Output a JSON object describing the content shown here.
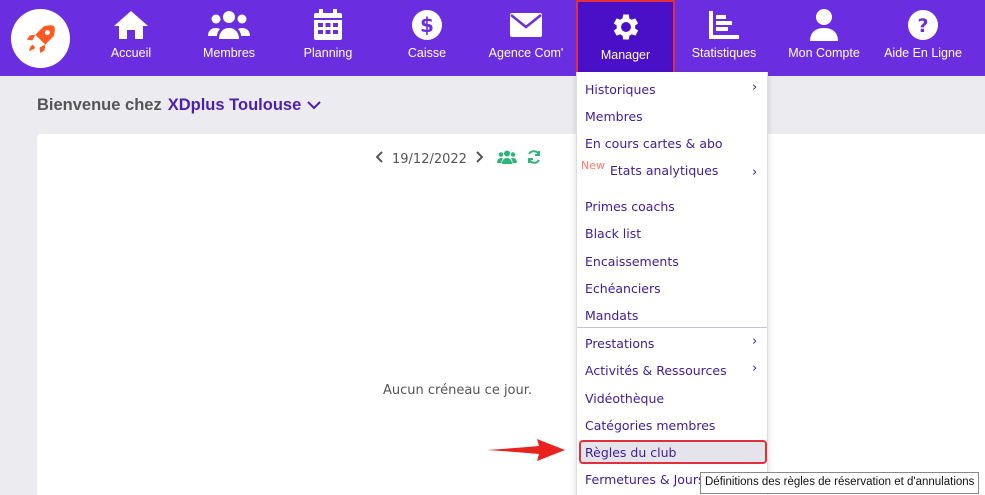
{
  "nav": {
    "items": [
      {
        "label": "Accueil",
        "icon": "home-icon"
      },
      {
        "label": "Membres",
        "icon": "members-icon"
      },
      {
        "label": "Planning",
        "icon": "calendar-icon"
      },
      {
        "label": "Caisse",
        "icon": "dollar-icon"
      },
      {
        "label": "Agence Com'",
        "icon": "envelope-icon"
      },
      {
        "label": "Manager",
        "icon": "gear-icon",
        "active": true
      },
      {
        "label": "Statistiques",
        "icon": "stats-icon"
      },
      {
        "label": "Mon Compte",
        "icon": "user-icon"
      },
      {
        "label": "Aide En Ligne",
        "icon": "help-icon"
      }
    ]
  },
  "welcome": {
    "prefix": "Bienvenue chez",
    "club": "XDplus Toulouse"
  },
  "planning": {
    "date": "19/12/2022",
    "empty_text": "Aucun créneau ce jour."
  },
  "menu": {
    "items": [
      {
        "label": "Historiques",
        "has_submenu": true
      },
      {
        "label": "Membres"
      },
      {
        "label": "En cours cartes & abo"
      },
      {
        "label": "Etats analytiques",
        "has_submenu": true,
        "badge": "New"
      },
      {
        "label": "Primes coachs"
      },
      {
        "label": "Black list"
      },
      {
        "label": "Encaissements"
      },
      {
        "label": "Echéanciers"
      },
      {
        "label": "Mandats"
      },
      {
        "label": "Prestations",
        "has_submenu": true
      },
      {
        "label": "Activités & Ressources",
        "has_submenu": true
      },
      {
        "label": "Vidéothèque"
      },
      {
        "label": "Catégories membres"
      },
      {
        "label": "Règles du club",
        "highlighted": true
      },
      {
        "label": "Fermetures & Jours"
      }
    ]
  },
  "tooltip": "Définitions des règles de réservation et d'annulations",
  "colors": {
    "brand": "#6b2de0",
    "active": "#4a10c8",
    "menu_text": "#3f1b99",
    "highlight_border": "#e1303c",
    "arrow": "#e8221e",
    "accent_green": "#2fb57a"
  }
}
